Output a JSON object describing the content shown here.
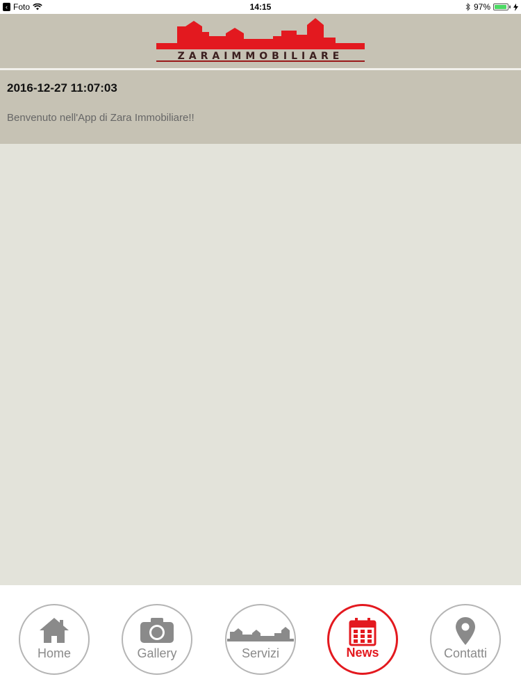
{
  "status_bar": {
    "back_app": "Foto",
    "time": "14:15",
    "battery": "97%",
    "battery_level": 0.97
  },
  "header": {
    "logo_text": "ZARAIMMOBILIARE"
  },
  "news": [
    {
      "date": "2016-12-27 11:07:03",
      "body": "Benvenuto nell'App di Zara Immobiliare!!"
    }
  ],
  "tabs": [
    {
      "label": "Home",
      "icon": "home-icon",
      "active": false
    },
    {
      "label": "Gallery",
      "icon": "camera-icon",
      "active": false
    },
    {
      "label": "Servizi",
      "icon": "skyline-icon",
      "active": false
    },
    {
      "label": "News",
      "icon": "calendar-icon",
      "active": true
    },
    {
      "label": "Contatti",
      "icon": "location-pin-icon",
      "active": false
    }
  ],
  "colors": {
    "brand_red": "#e3191f",
    "header_bg": "#c6c2b4",
    "page_bg": "#e3e3da",
    "tab_inactive": "#8a8a8a"
  }
}
